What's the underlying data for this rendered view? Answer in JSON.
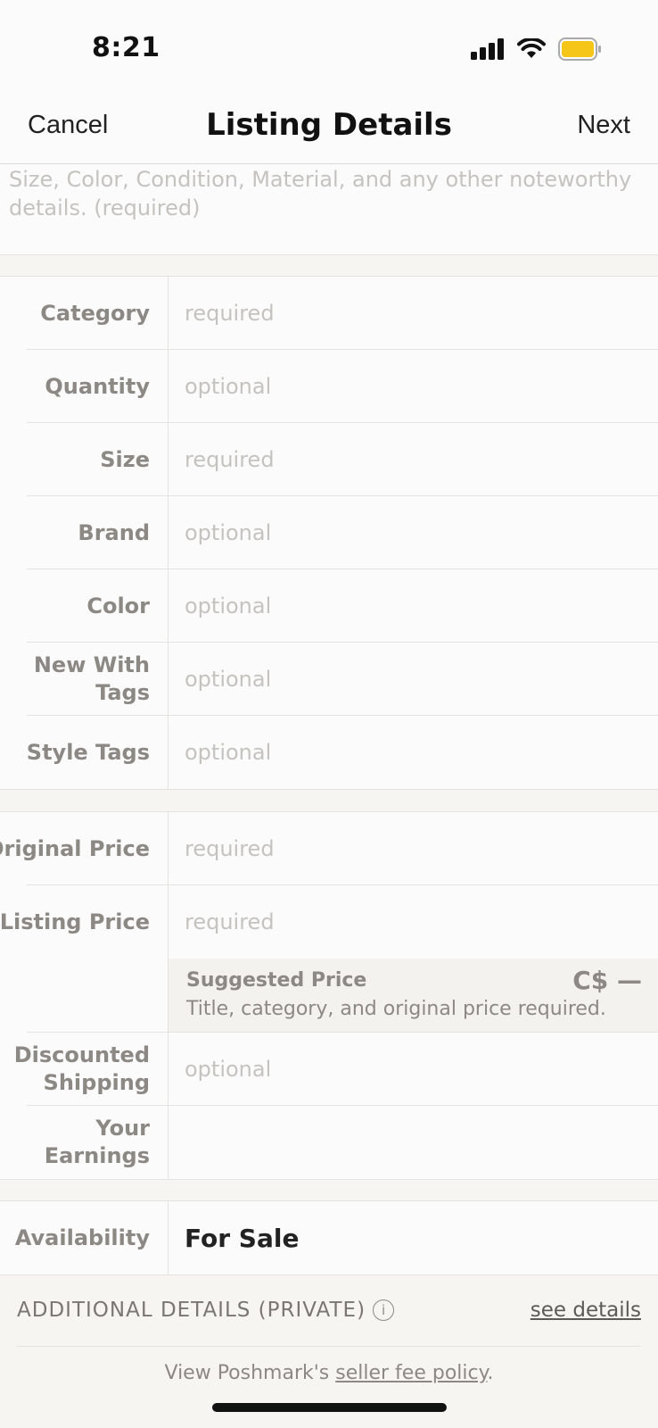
{
  "status_bar": {
    "time": "8:21",
    "battery_color": "#f5c518"
  },
  "nav": {
    "cancel": "Cancel",
    "title": "Listing Details",
    "next": "Next"
  },
  "description": {
    "placeholder": "Size, Color, Condition, Material, and any other noteworthy details. (required)"
  },
  "details_section": [
    {
      "label": "Category",
      "value": "required"
    },
    {
      "label": "Quantity",
      "value": "optional"
    },
    {
      "label": "Size",
      "value": "required"
    },
    {
      "label": "Brand",
      "value": "optional"
    },
    {
      "label": "Color",
      "value": "optional"
    },
    {
      "label": "New With Tags",
      "value": "optional"
    },
    {
      "label": "Style Tags",
      "value": "optional"
    }
  ],
  "price_section": {
    "original_price": {
      "label": "Original Price",
      "value": "required"
    },
    "listing_price": {
      "label": "Listing Price",
      "value": "required"
    },
    "suggested": {
      "title": "Suggested Price",
      "price": "C$ —",
      "subtitle": "Title, category, and original price required."
    },
    "discounted_shipping": {
      "label": "Discounted Shipping",
      "value": "optional"
    },
    "earnings": {
      "label": "Your Earnings",
      "value": ""
    }
  },
  "availability": {
    "label": "Availability",
    "value": "For Sale"
  },
  "additional": {
    "title": "ADDITIONAL DETAILS (PRIVATE)",
    "info_icon": "info-icon",
    "link": "see details"
  },
  "policy": {
    "prefix": "View Poshmark's ",
    "link": "seller fee policy",
    "suffix": "."
  }
}
